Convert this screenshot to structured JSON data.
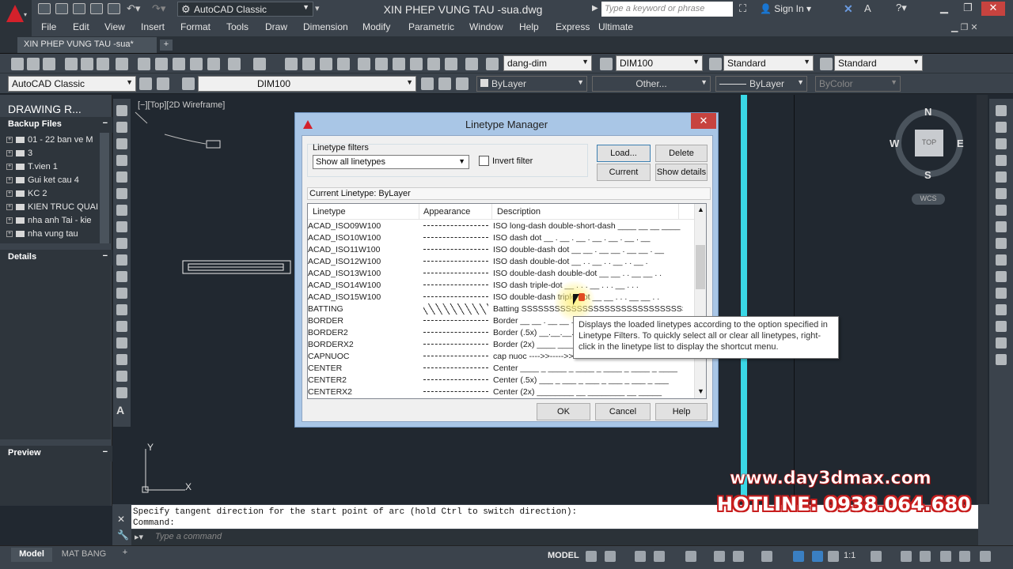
{
  "window": {
    "workspace": "AutoCAD Classic",
    "title": "XIN PHEP VUNG TAU -sua.dwg",
    "search_placeholder": "Type a keyword or phrase",
    "signin": "Sign In"
  },
  "menu": [
    "File",
    "Edit",
    "View",
    "Insert",
    "Format",
    "Tools",
    "Draw",
    "Dimension",
    "Modify",
    "Parametric",
    "Window",
    "Help",
    "Express",
    "Ultimate"
  ],
  "doc_tab": "XIN PHEP VUNG TAU -sua*",
  "toolbar": {
    "dimstyle": "dang-dim",
    "dimstyle2": "DIM100",
    "textstyle": "Standard",
    "tablestyle": "Standard",
    "workspace2": "AutoCAD Classic",
    "layer": "DIM100",
    "color": "ByLayer",
    "linetype": "Other...",
    "lineweight": "ByLayer",
    "plotstyle": "ByColor"
  },
  "palette": {
    "title": "DRAWING R...",
    "backup": "Backup Files",
    "items": [
      "01 - 22 ban ve M",
      "3",
      "T.vien 1",
      "Gui ket cau 4",
      "KC 2",
      "KIEN TRUC QUAI",
      "nha anh Tai - kie",
      "nha vung tau"
    ],
    "details": "Details",
    "preview": "Preview"
  },
  "viewport_label": "[−][Top][2D Wireframe]",
  "viewcube": {
    "n": "N",
    "s": "S",
    "e": "E",
    "w": "W",
    "top": "TOP",
    "wcs": "WCS"
  },
  "dialog": {
    "title": "Linetype Manager",
    "filters_label": "Linetype filters",
    "filter_value": "Show all linetypes",
    "invert": "Invert filter",
    "load": "Load...",
    "delete": "Delete",
    "current": "Current",
    "show_details": "Show details",
    "current_linetype": "Current Linetype:  ByLayer",
    "columns": [
      "Linetype",
      "Appearance",
      "Description"
    ],
    "rows": [
      {
        "name": "ACAD_ISO09W100",
        "desc": "ISO long-dash double-short-dash ____ __ __ ____"
      },
      {
        "name": "ACAD_ISO10W100",
        "desc": "ISO dash dot __ . __ . __ . __ . __ . __ . __"
      },
      {
        "name": "ACAD_ISO11W100",
        "desc": "ISO double-dash dot __ __ . __ __ . __ __ . __"
      },
      {
        "name": "ACAD_ISO12W100",
        "desc": "ISO dash double-dot __ . . __ . . __ . . __ ."
      },
      {
        "name": "ACAD_ISO13W100",
        "desc": "ISO double-dash double-dot __ __ . . __ __ . ."
      },
      {
        "name": "ACAD_ISO14W100",
        "desc": "ISO dash triple-dot __ . . . __ . . . __ . . ."
      },
      {
        "name": "ACAD_ISO15W100",
        "desc": "ISO double-dash triple-dot __ __ . . . __ __ . ."
      },
      {
        "name": "BATTING",
        "desc": "Batting SSSSSSSSSSSSSSSSSSSSSSSSSSSSSSSSSSS"
      },
      {
        "name": "BORDER",
        "desc": "Border __ __ . __ __ . __ __ . __ __ . __ __ ."
      },
      {
        "name": "BORDER2",
        "desc": "Border (.5x) __.__.__.__.__.__.__.__.__.__."
      },
      {
        "name": "BORDERX2",
        "desc": "Border (2x) ____ ____ . ____ ____ . ___"
      },
      {
        "name": "CAPNUOC",
        "desc": "cap nuoc ---->>----->>-----"
      },
      {
        "name": "CENTER",
        "desc": "Center ____ _ ____ _ ____ _ ____ _ ____ _ ____"
      },
      {
        "name": "CENTER2",
        "desc": "Center (.5x) ___ _ ___ _ ___ _ ___ _ ___ _ ___"
      },
      {
        "name": "CENTERX2",
        "desc": "Center (2x) ________ __ ________ __ _____"
      }
    ],
    "ok": "OK",
    "cancel": "Cancel",
    "help": "Help"
  },
  "tooltip": "Displays the loaded linetypes according to the option specified in Linetype Filters. To quickly select all or clear all linetypes, right-click in the linetype list to display the shortcut menu.",
  "command": {
    "line1": "Specify tangent direction for the start point of arc (hold Ctrl to switch direction):",
    "line2": "Command:",
    "placeholder": "Type a command"
  },
  "status": {
    "model_tab": "Model",
    "layout_tab": "MAT BANG",
    "model": "MODEL",
    "scale": "1:1"
  },
  "watermark": {
    "url": "www.day3dmax.com",
    "hotline": "HOTLINE: 0938.064.680"
  },
  "colors": {
    "accent_red": "#d4212b",
    "cyan_line": "#3ad8e6",
    "dialog_frame": "#a9c6e6"
  }
}
